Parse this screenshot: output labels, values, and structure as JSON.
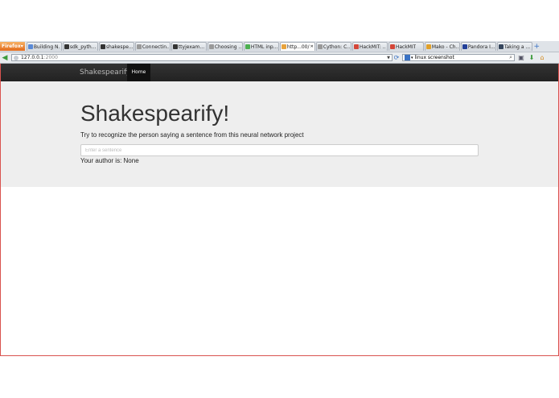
{
  "browser": {
    "menu_label": "Firefox",
    "tabs": [
      {
        "label": "Building N...",
        "icon": "globe-icon",
        "color": "#5a8ad6"
      },
      {
        "label": "sdk_pyth...",
        "icon": "github-icon",
        "color": "#333333"
      },
      {
        "label": "shakespe...",
        "icon": "github-icon",
        "color": "#333333"
      },
      {
        "label": "Connectin...",
        "icon": "page-icon",
        "color": "#999999"
      },
      {
        "label": "ttyjexam...",
        "icon": "github-icon",
        "color": "#333333"
      },
      {
        "label": "Choosing ...",
        "icon": "page-icon",
        "color": "#999999"
      },
      {
        "label": "HTML inp...",
        "icon": "w3-icon",
        "color": "#4caf50"
      },
      {
        "label": "http...00/",
        "icon": "loading-icon",
        "color": "#e8a33c",
        "active": true
      },
      {
        "label": "Cython: C...",
        "icon": "page-icon",
        "color": "#999999"
      },
      {
        "label": "HackMIT: ...",
        "icon": "gmail-icon",
        "color": "#d44638"
      },
      {
        "label": "HackMIT",
        "icon": "gmail-icon",
        "color": "#d44638"
      },
      {
        "label": "Mako - Ch...",
        "icon": "python-icon",
        "color": "#e0a02a"
      },
      {
        "label": "Pandora I...",
        "icon": "pandora-icon",
        "color": "#224099"
      },
      {
        "label": "Taking a ...",
        "icon": "tumblr-icon",
        "color": "#36465d"
      }
    ],
    "url_host": "127.0.0.1",
    "url_port": ":2000",
    "search_value": "linux screenshot"
  },
  "site": {
    "brand": "Shakespearify",
    "nav_home": "Home"
  },
  "main": {
    "title": "Shakespearify!",
    "subtitle": "Try to recognize the person saying a sentence from this neural network project",
    "input_placeholder": "Enter a sentence",
    "input_value": "",
    "author_label": "Your author is: None"
  }
}
